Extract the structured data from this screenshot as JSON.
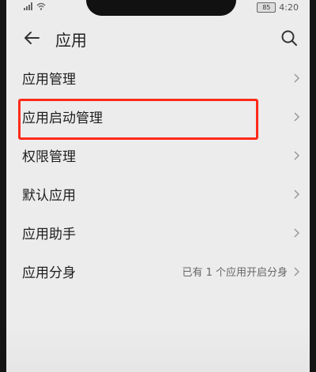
{
  "status": {
    "battery": "85",
    "time": "4:20"
  },
  "header": {
    "title": "应用"
  },
  "list": {
    "items": [
      {
        "label": "应用管理",
        "value": ""
      },
      {
        "label": "应用启动管理",
        "value": ""
      },
      {
        "label": "权限管理",
        "value": ""
      },
      {
        "label": "默认应用",
        "value": ""
      },
      {
        "label": "应用助手",
        "value": ""
      },
      {
        "label": "应用分身",
        "value": "已有 1 个应用开启分身"
      }
    ]
  },
  "colors": {
    "highlight": "#ff2a1a",
    "background": "#ececec"
  },
  "icons": [
    "back-arrow-icon",
    "search-icon",
    "chevron-right-icon",
    "signal-icon",
    "wifi-icon",
    "battery-icon"
  ]
}
